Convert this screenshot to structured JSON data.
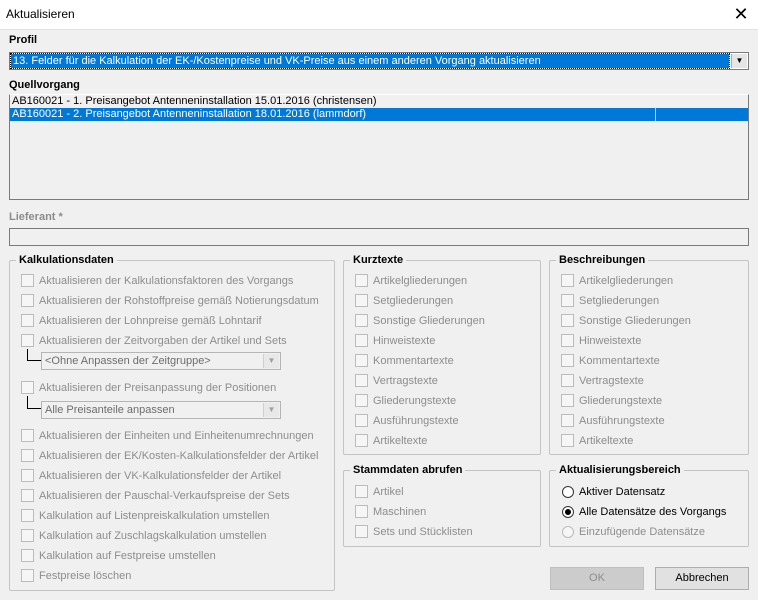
{
  "window": {
    "title": "Aktualisieren",
    "close_glyph": "✕"
  },
  "profil": {
    "label": "Profil",
    "value": "13. Felder für die Kalkulation der EK-/Kostenpreise und VK-Preise aus einem anderen Vorgang aktualisieren"
  },
  "quellvorgang": {
    "label": "Quellvorgang",
    "items": [
      "AB160021 - 1. Preisangebot Antenneninstallation 15.01.2016 (christensen)",
      "AB160021 - 2. Preisangebot Antenneninstallation 18.01.2016 (lammdorf)"
    ]
  },
  "lieferant": {
    "label": "Lieferant *",
    "value": ""
  },
  "kalkulationsdaten": {
    "title": "Kalkulationsdaten",
    "items": [
      "Aktualisieren der Kalkulationsfaktoren des Vorgangs",
      "Aktualisieren der Rohstoffpreise gemäß Notierungsdatum",
      "Aktualisieren der Lohnpreise gemäß Lohntarif",
      "Aktualisieren der Zeitvorgaben der Artikel und Sets",
      "Aktualisieren der Preisanpassung der Positionen",
      "Aktualisieren der Einheiten und Einheitenumrechnungen",
      "Aktualisieren der EK/Kosten-Kalkulationsfelder der Artikel",
      "Aktualisieren der VK-Kalkulationsfelder der Artikel",
      "Aktualisieren der Pauschal-Verkaufspreise der Sets",
      "Kalkulation auf Listenpreiskalkulation umstellen",
      "Kalkulation auf Zuschlagskalkulation umstellen",
      "Kalkulation auf Festpreise umstellen",
      "Festpreise löschen"
    ],
    "zeitgruppe_combo": "<Ohne Anpassen der Zeitgruppe>",
    "preisanteile_combo": "Alle Preisanteile anpassen"
  },
  "kurztexte": {
    "title": "Kurztexte",
    "items": [
      "Artikelgliederungen",
      "Setgliederungen",
      "Sonstige Gliederungen",
      "Hinweistexte",
      "Kommentartexte",
      "Vertragstexte",
      "Gliederungstexte",
      "Ausführungstexte",
      "Artikeltexte"
    ]
  },
  "beschreibungen": {
    "title": "Beschreibungen",
    "items": [
      "Artikelgliederungen",
      "Setgliederungen",
      "Sonstige Gliederungen",
      "Hinweistexte",
      "Kommentartexte",
      "Vertragstexte",
      "Gliederungstexte",
      "Ausführungstexte",
      "Artikeltexte"
    ]
  },
  "stammdaten": {
    "title": "Stammdaten abrufen",
    "items": [
      "Artikel",
      "Maschinen",
      "Sets und Stücklisten"
    ]
  },
  "bereich": {
    "title": "Aktualisierungsbereich",
    "options": [
      "Aktiver Datensatz",
      "Alle Datensätze des Vorgangs",
      "Einzufügende Datensätze"
    ],
    "selected": "Alle Datensätze des Vorgangs"
  },
  "buttons": {
    "ok": "OK",
    "cancel": "Abbrechen"
  },
  "icons": {
    "combo_arrow": "▼"
  },
  "colors": {
    "selection": "#0078d7"
  }
}
